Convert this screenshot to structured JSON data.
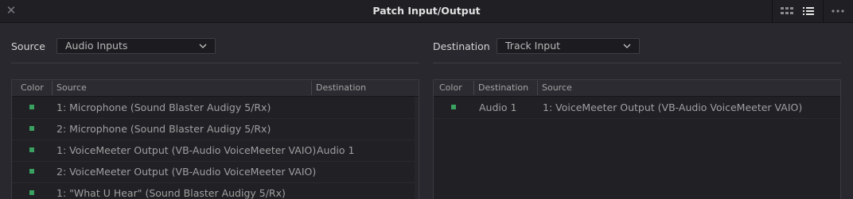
{
  "window": {
    "title": "Patch Input/Output"
  },
  "colors": {
    "swatch": "#3aa160"
  },
  "icons": {
    "close": "close-icon",
    "grid_view": "grid-view-icon",
    "list_view": "list-view-icon",
    "more": "more-options-icon"
  },
  "left": {
    "label": "Source",
    "dropdown_value": "Audio Inputs",
    "columns": [
      "Color",
      "Source",
      "Destination"
    ],
    "rows": [
      {
        "source": "1: Microphone (Sound Blaster Audigy 5/Rx)",
        "destination": ""
      },
      {
        "source": "2: Microphone (Sound Blaster Audigy 5/Rx)",
        "destination": ""
      },
      {
        "source": "1: VoiceMeeter Output (VB-Audio VoiceMeeter VAIO)",
        "destination": "Audio 1"
      },
      {
        "source": "2: VoiceMeeter Output (VB-Audio VoiceMeeter VAIO)",
        "destination": ""
      },
      {
        "source": "1: \"What U Hear\" (Sound Blaster Audigy 5/Rx)",
        "destination": ""
      }
    ]
  },
  "right": {
    "label": "Destination",
    "dropdown_value": "Track Input",
    "columns": [
      "Color",
      "Destination",
      "Source"
    ],
    "rows": [
      {
        "destination": "Audio 1",
        "source": "1: VoiceMeeter Output (VB-Audio VoiceMeeter VAIO)"
      }
    ]
  }
}
